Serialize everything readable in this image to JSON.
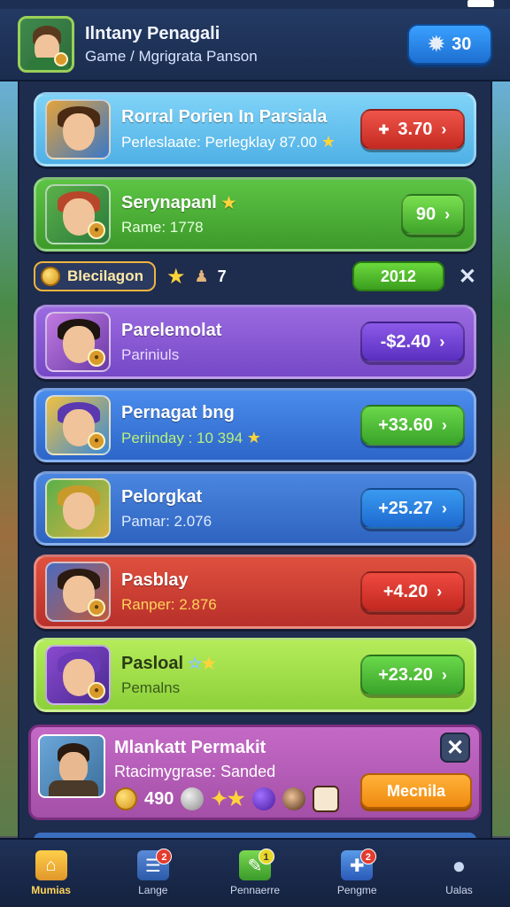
{
  "colors": {
    "blue_card": "#5fc1f0",
    "green_card": "#4bb13a",
    "purple_card": "#8a5bd6",
    "blue2_card": "#3a7be0",
    "blue3_card": "#3c7fd9",
    "red_card": "#d9423a",
    "lime_card": "#a8e34a",
    "red_button": "#e23a30",
    "green_button": "#4cc02c",
    "purple_button": "#7a4ad8",
    "blue_button": "#2b86e6"
  },
  "header": {
    "title": "Ilntany Penagali",
    "subtitle": "Game / Mgrigrata Panson",
    "gem_value": "30",
    "gem_icon": "gear-gem-icon"
  },
  "cards": [
    {
      "title": "Rorral Porien In Parsiala",
      "sub": "Perleslaate: Perlegklay 87.00",
      "star": true,
      "price": "3.70"
    },
    {
      "title": "Serynapanl",
      "sub": "Rame: 1778",
      "star": true,
      "price": "90"
    },
    {
      "title": "Parelemolat",
      "sub": "Pariniuls",
      "star": false,
      "price": "-$2.40"
    },
    {
      "title": "Pernagat bng",
      "sub": "Periinday : 10 394",
      "star": true,
      "price": "+33.60"
    },
    {
      "title": "Pelorgkat",
      "sub": "Pamar: 2.076",
      "star": false,
      "price": "+25.27"
    },
    {
      "title": "Pasblay",
      "sub": "Ranper: 2.876",
      "star": false,
      "price": "+4.20"
    },
    {
      "title": "Pasloal",
      "sub": "Pemalns",
      "star": true,
      "price": "+23.20"
    }
  ],
  "separator": {
    "label": "Blecilagon",
    "count": "7",
    "chip_value": "2012"
  },
  "promo": {
    "title": "Mlankatt Permakit",
    "sub": "Rtacimygrase: Sanded",
    "coins": "490",
    "button": "Mecnila"
  },
  "nav": [
    {
      "label": "Mumias",
      "icon": "home-icon",
      "badge": ""
    },
    {
      "label": "Lange",
      "icon": "news-icon",
      "badge": "2"
    },
    {
      "label": "Pennaerre",
      "icon": "edit-icon",
      "badge": "1"
    },
    {
      "label": "Pengme",
      "icon": "tools-icon",
      "badge": "2"
    },
    {
      "label": "Ualas",
      "icon": "profile-icon",
      "badge": ""
    }
  ]
}
